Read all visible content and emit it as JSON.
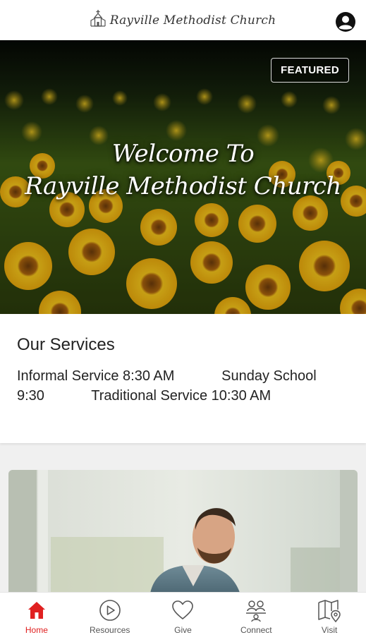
{
  "header": {
    "title": "Rayville Methodist Church",
    "logo_icon": "church-icon",
    "profile_icon": "account-icon"
  },
  "hero": {
    "badge": "FEATURED",
    "title_line1": "Welcome To",
    "title_line2": "Rayville Methodist Church"
  },
  "services": {
    "heading": "Our Services",
    "text": "Informal Service 8:30 AM            Sunday School  9:30            Traditional Service 10:30 AM"
  },
  "nav": {
    "items": [
      {
        "label": "Home",
        "icon": "home-icon",
        "active": true
      },
      {
        "label": "Resources",
        "icon": "play-circle-icon",
        "active": false
      },
      {
        "label": "Give",
        "icon": "heart-icon",
        "active": false
      },
      {
        "label": "Connect",
        "icon": "people-icon",
        "active": false
      },
      {
        "label": "Visit",
        "icon": "map-pin-icon",
        "active": false
      }
    ]
  },
  "colors": {
    "accent": "#e02020",
    "nav_inactive": "#555555"
  }
}
